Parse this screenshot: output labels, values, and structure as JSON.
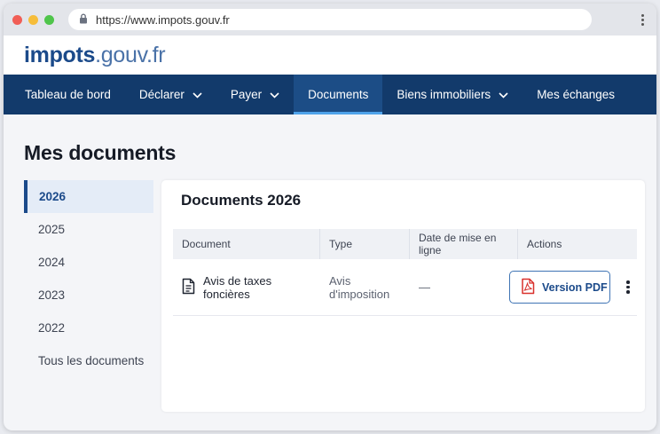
{
  "browser": {
    "url": "https://www.impots.gouv.fr"
  },
  "site": {
    "logo_brand": "impots",
    "logo_domain": ".gouv.fr"
  },
  "nav": {
    "items": [
      {
        "label": "Tableau de bord"
      },
      {
        "label": "Déclarer"
      },
      {
        "label": "Payer"
      },
      {
        "label": "Documents"
      },
      {
        "label": "Biens immobiliers"
      },
      {
        "label": "Mes échanges"
      }
    ]
  },
  "page": {
    "title": "Mes documents"
  },
  "years": {
    "items": [
      "2026",
      "2025",
      "2024",
      "2023",
      "2022",
      "Tous les documents"
    ],
    "selected": "2026"
  },
  "panel": {
    "title": "Documents 2026",
    "columns": [
      "Document",
      "Type",
      "Date de mise en ligne",
      "Actions"
    ],
    "rows": [
      {
        "document": "Avis de taxes foncières",
        "type": "Avis d'imposition",
        "date": "—",
        "action_label": "Version PDF"
      }
    ]
  },
  "colors": {
    "nav_background": "#123a6b",
    "nav_active": "#1c4d86",
    "active_underline": "#4fa3ea",
    "brand_blue": "#1b4a8a",
    "pdf_red": "#d9302c"
  },
  "icons": {
    "lock": "lock-icon",
    "chevron": "chevron-down-icon",
    "document": "document-icon",
    "pdf": "pdf-icon",
    "more": "more-vertical-icon"
  }
}
